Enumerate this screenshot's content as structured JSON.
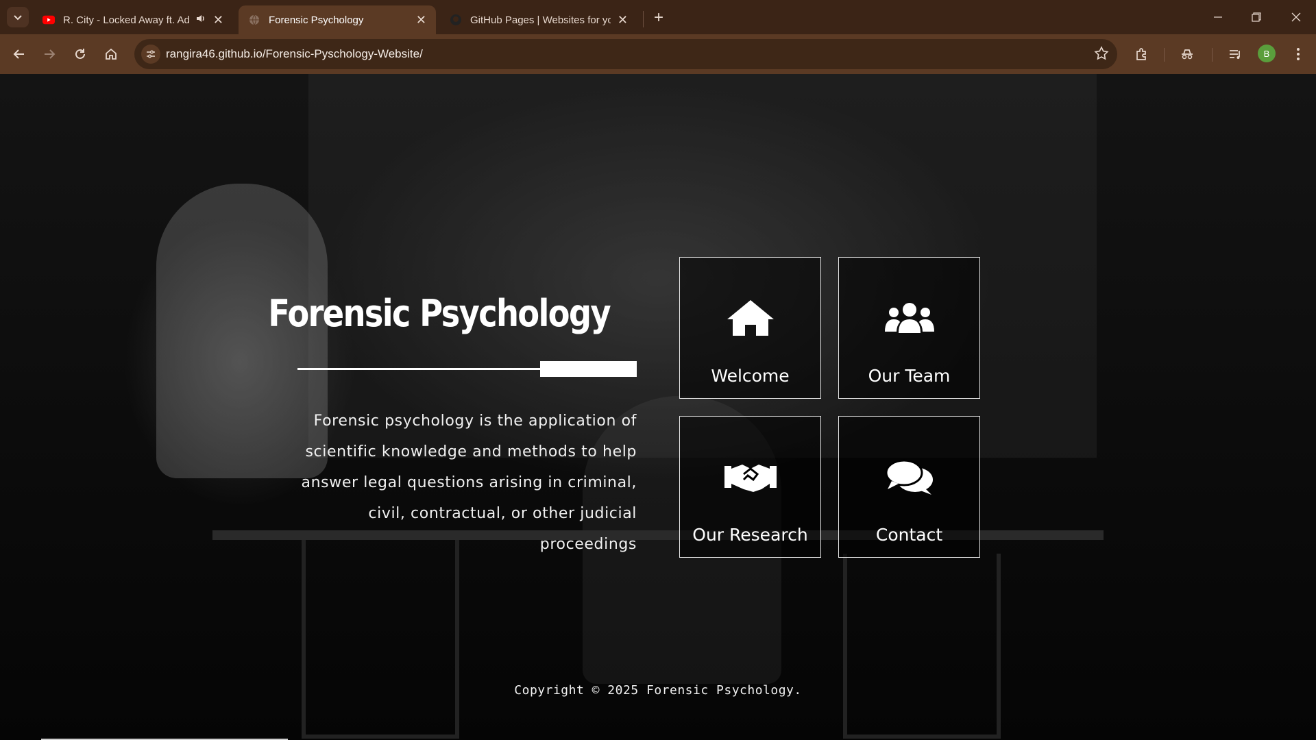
{
  "browser": {
    "tabs": [
      {
        "title": "R. City - Locked Away ft. Adam Levine",
        "favicon": "youtube-icon",
        "audio": true,
        "active": false
      },
      {
        "title": "Forensic Psychology",
        "favicon": "globe-icon",
        "active": true
      },
      {
        "title": "GitHub Pages | Websites for you and your projects",
        "favicon": "github-icon",
        "active": false
      }
    ],
    "url": "rangira46.github.io/Forensic-Pyschology-Website/",
    "profile_initial": "B",
    "accent": "#5b3a24"
  },
  "hero": {
    "title": "Forensic Psychology",
    "description": "Forensic psychology is the application of scientific knowledge and methods to help answer legal questions arising in criminal, civil, contractual, or other judicial proceedings"
  },
  "nav_cards": [
    {
      "label": "Welcome",
      "icon": "home-icon"
    },
    {
      "label": "Our Team",
      "icon": "users-icon"
    },
    {
      "label": "Our Research",
      "icon": "handshake-icon"
    },
    {
      "label": "Contact",
      "icon": "comments-icon"
    }
  ],
  "footer": {
    "copyright": "Copyright © 2025 Forensic Psychology."
  }
}
